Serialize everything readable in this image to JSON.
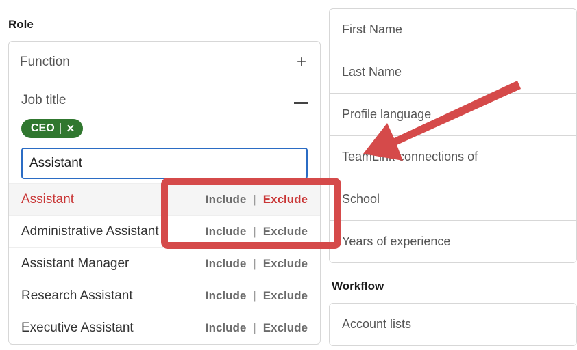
{
  "left": {
    "section_label": "Role",
    "function": {
      "title": "Function"
    },
    "job_title": {
      "title": "Job title",
      "chip": {
        "label": "CEO"
      },
      "search_value": "Assistant",
      "suggestions": [
        {
          "label": "Assistant",
          "include": "Include",
          "exclude": "Exclude",
          "active": true
        },
        {
          "label": "Administrative Assistant",
          "include": "Include",
          "exclude": "Exclude",
          "active": false
        },
        {
          "label": "Assistant Manager",
          "include": "Include",
          "exclude": "Exclude",
          "active": false
        },
        {
          "label": "Research Assistant",
          "include": "Include",
          "exclude": "Exclude",
          "active": false
        },
        {
          "label": "Executive Assistant",
          "include": "Include",
          "exclude": "Exclude",
          "active": false
        }
      ]
    }
  },
  "right": {
    "filters": [
      "First Name",
      "Last Name",
      "Profile language",
      "TeamLink connections of",
      "School",
      "Years of experience"
    ],
    "workflow_label": "Workflow",
    "workflow_items": [
      "Account lists"
    ]
  }
}
